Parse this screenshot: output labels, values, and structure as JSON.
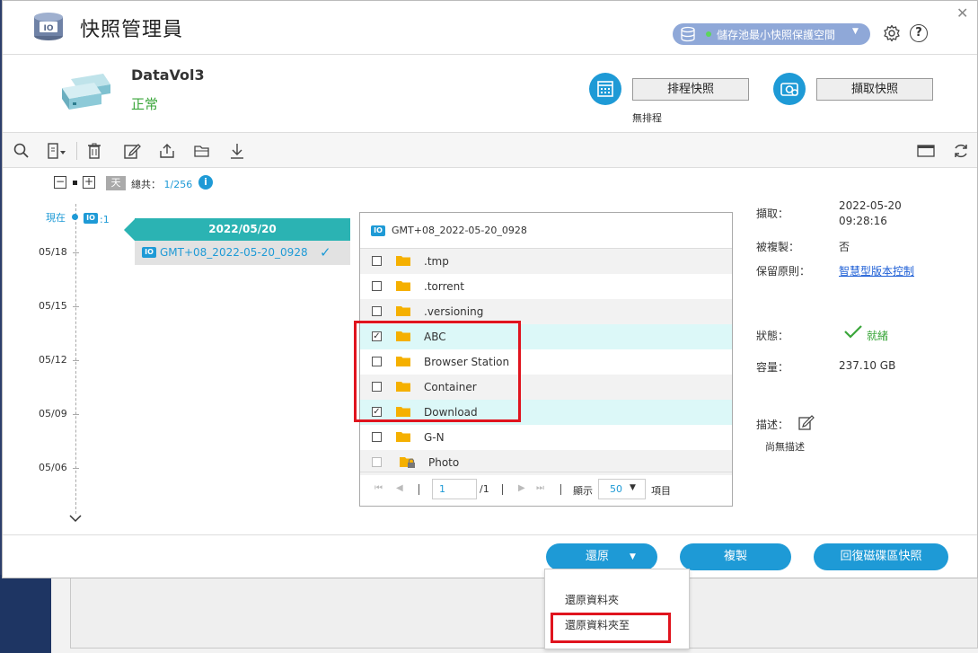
{
  "app": {
    "title": "快照管理員",
    "pool_button": "儲存池最小快照保護空間"
  },
  "volume": {
    "name": "DataVol3",
    "status": "正常"
  },
  "actions": {
    "schedule_button": "排程快照",
    "schedule_status": "無排程",
    "take_snapshot_button": "擷取快照"
  },
  "zoom": {
    "day_label": "天",
    "total_label": "總共：",
    "total_value": "1/256"
  },
  "timeline": {
    "now_label": "現在",
    "snap_count": ":1",
    "dates": [
      "05/18",
      "05/15",
      "05/12",
      "05/09",
      "05/06"
    ]
  },
  "snapshot_group": {
    "date": "2022/05/20",
    "snapshot_name": "GMT+08_2022-05-20_0928"
  },
  "file_browser": {
    "header": "GMT+08_2022-05-20_0928",
    "items": [
      {
        "name": ".tmp",
        "checked": false
      },
      {
        "name": ".torrent",
        "checked": false
      },
      {
        "name": ".versioning",
        "checked": false
      },
      {
        "name": "ABC",
        "checked": true
      },
      {
        "name": "Browser Station",
        "checked": false
      },
      {
        "name": "Container",
        "checked": false
      },
      {
        "name": "Download",
        "checked": true
      },
      {
        "name": "G-N",
        "checked": false
      },
      {
        "name": "Photo",
        "checked": false,
        "locked": true
      }
    ],
    "pager": {
      "page": "1",
      "of": "/1",
      "show_label": "顯示",
      "page_size": "50",
      "items_label": "項目"
    }
  },
  "details": {
    "taken_label": "擷取：",
    "taken_value": "2022-05-20\n09:28:16",
    "cloned_label": "被複製：",
    "cloned_value": "否",
    "retention_label": "保留原則：",
    "retention_value": "智慧型版本控制",
    "status_label": "狀態：",
    "status_value": "就緒",
    "capacity_label": "容量：",
    "capacity_value": "237.10 GB",
    "desc_label": "描述：",
    "desc_value": "尚無描述"
  },
  "footer": {
    "restore_button": "還原",
    "copy_button": "複製",
    "revert_button": "回復磁碟區快照"
  },
  "restore_menu": {
    "items": [
      "還原資料夾",
      "還原資料夾至"
    ]
  },
  "colors": {
    "accent": "#1e9ad6",
    "teal": "#2bb3b3",
    "ok": "#3aa63a",
    "highlight": "#e0141e"
  }
}
